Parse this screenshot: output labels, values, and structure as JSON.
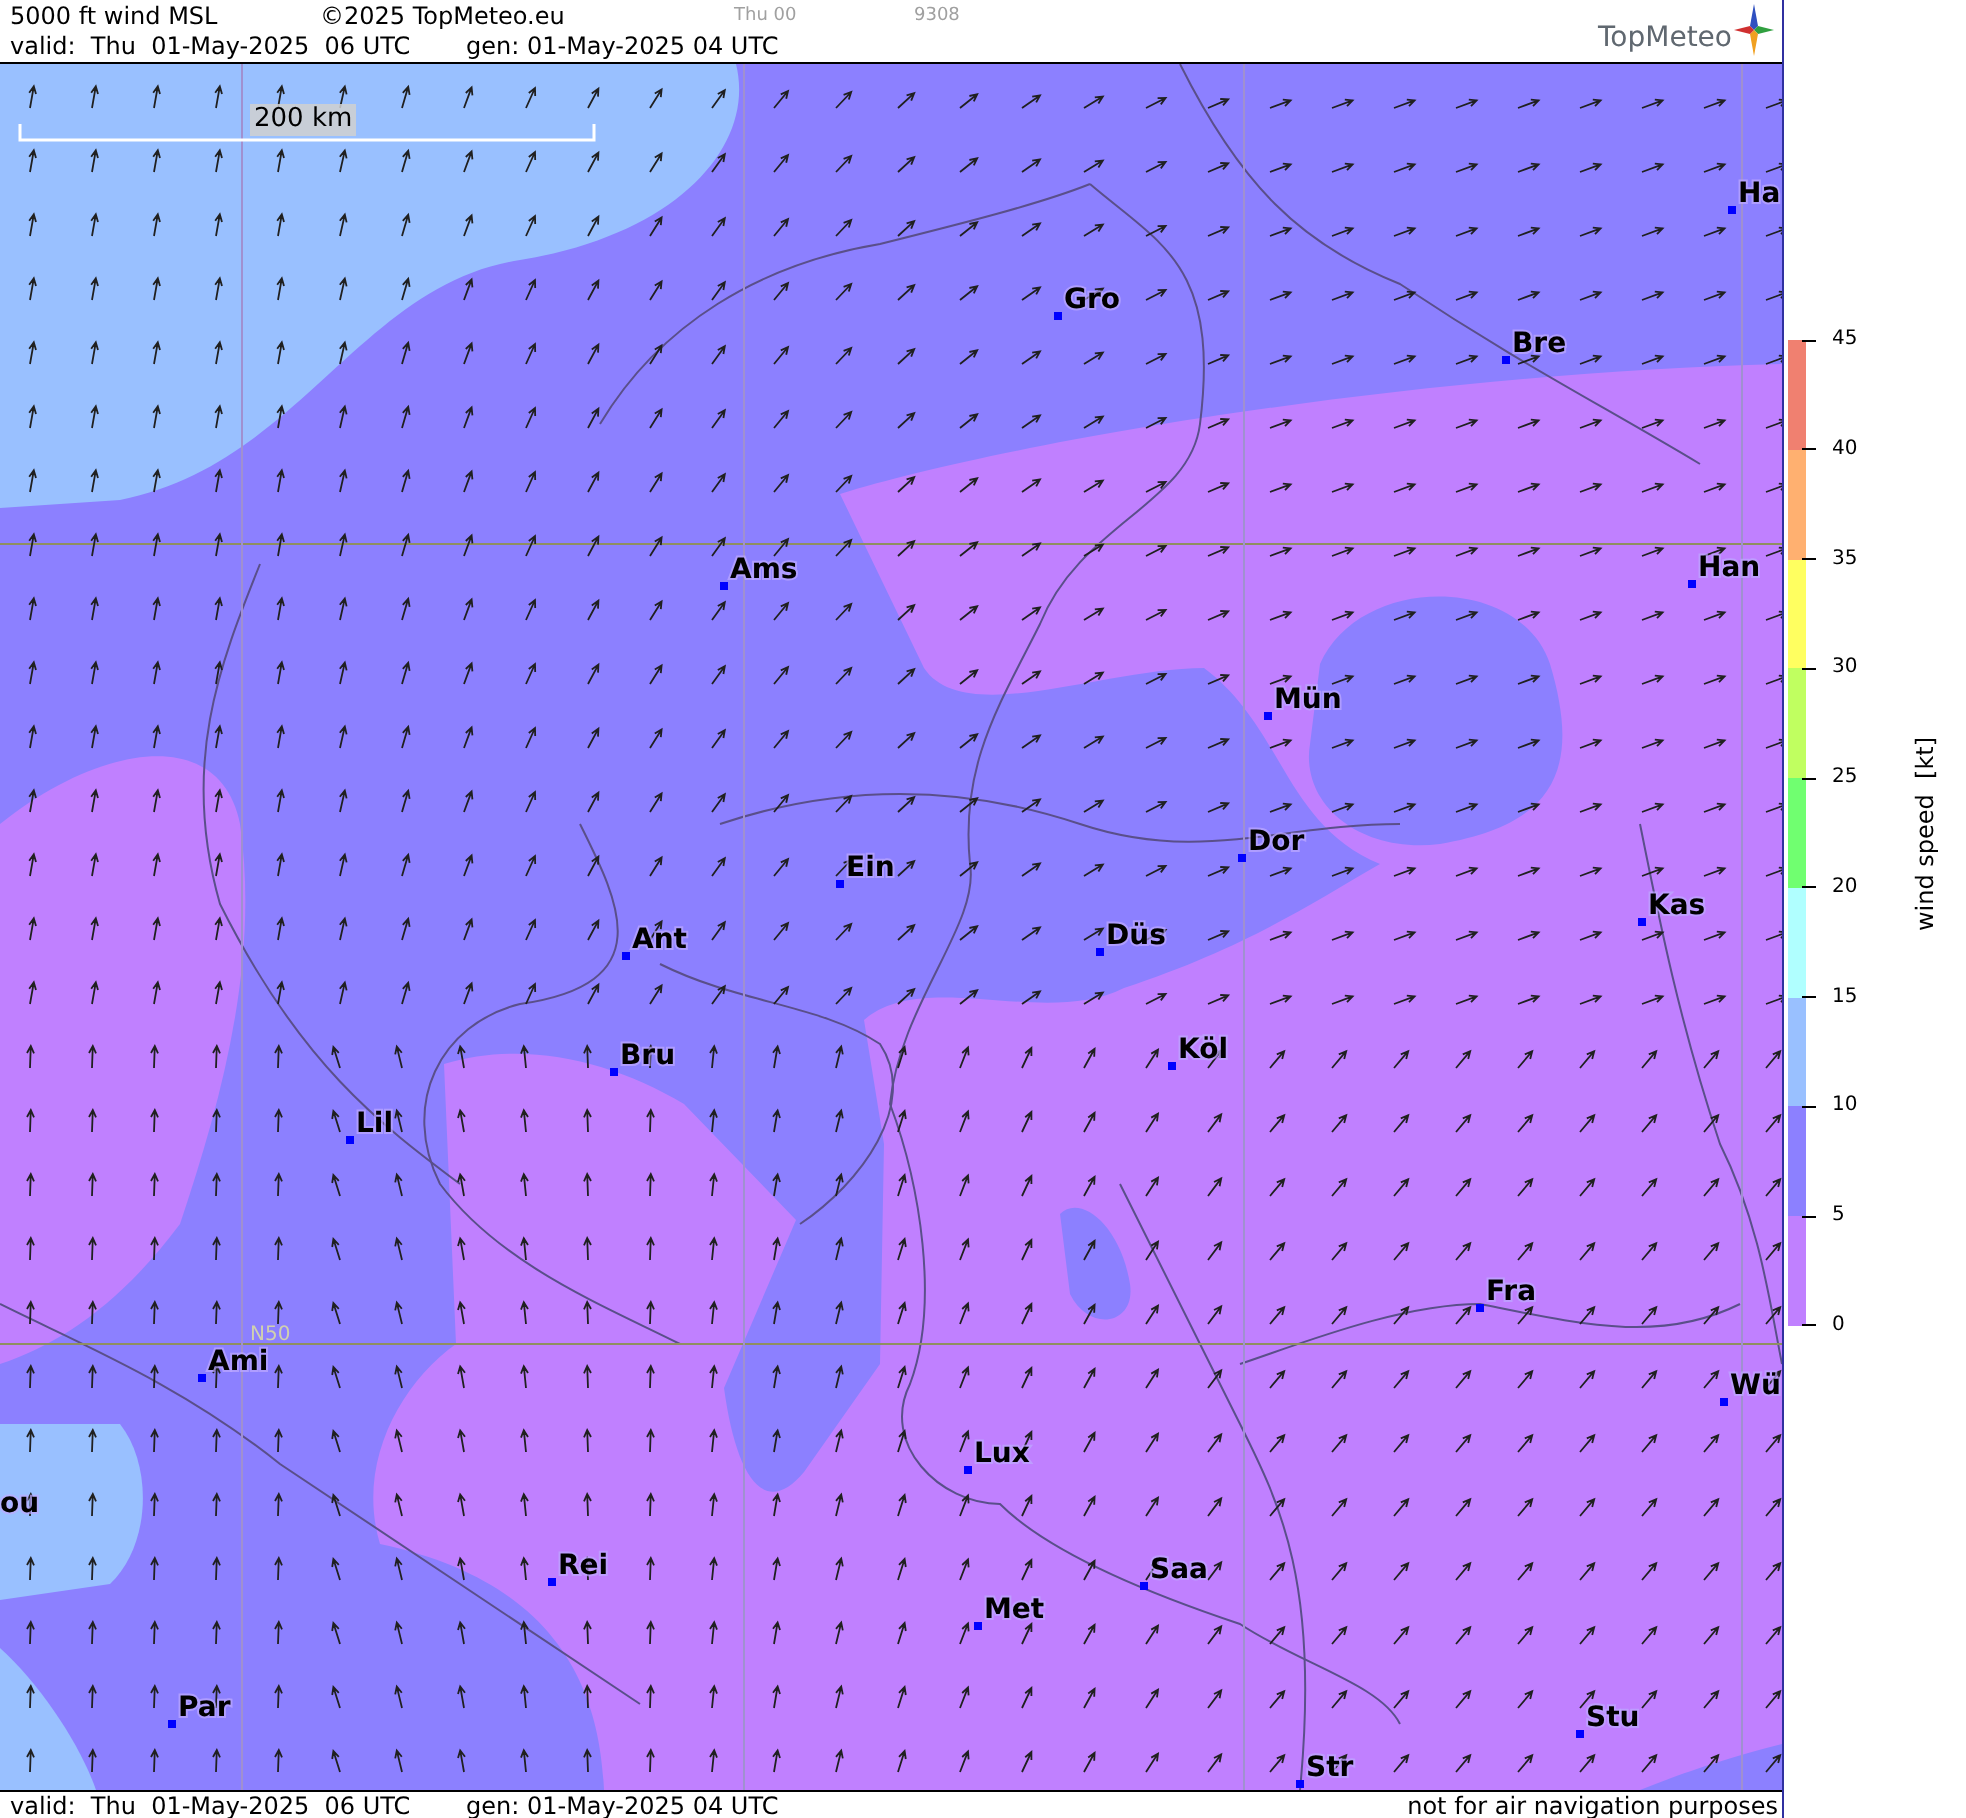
{
  "header": {
    "title": "5000 ft wind MSL",
    "copyright": "©2025 TopMeteo.eu",
    "run": "Thu 00",
    "code": "9308",
    "valid": "valid:  Thu  01-May-2025  06 UTC",
    "generated": "gen: 01-May-2025 04 UTC",
    "logo": "TopMeteo"
  },
  "map": {
    "scale_label": "200 km",
    "latitude_label": "N50",
    "cities": [
      {
        "name": "Ha"
      },
      {
        "name": "Gro"
      },
      {
        "name": "Bre"
      },
      {
        "name": "Ams"
      },
      {
        "name": "Han"
      },
      {
        "name": "Mün"
      },
      {
        "name": "Ein"
      },
      {
        "name": "Dor"
      },
      {
        "name": "Kas"
      },
      {
        "name": "Ant"
      },
      {
        "name": "Düs"
      },
      {
        "name": "Bru"
      },
      {
        "name": "Köl"
      },
      {
        "name": "Lil"
      },
      {
        "name": "Fra"
      },
      {
        "name": "Ami"
      },
      {
        "name": "Wü"
      },
      {
        "name": "Lux"
      },
      {
        "name": "ou"
      },
      {
        "name": "Rei"
      },
      {
        "name": "Saa"
      },
      {
        "name": "Met"
      },
      {
        "name": "Par"
      },
      {
        "name": "Stu"
      },
      {
        "name": "Str"
      }
    ]
  },
  "legend": {
    "title": "wind speed  [kt]",
    "ticks": [
      "45",
      "40",
      "35",
      "30",
      "25",
      "20",
      "15",
      "10",
      "5",
      "0"
    ],
    "bands": [
      {
        "color": "#f08070"
      },
      {
        "color": "#ffb070"
      },
      {
        "color": "#ffff60"
      },
      {
        "color": "#c0ff60"
      },
      {
        "color": "#70ff70"
      },
      {
        "color": "#b0ffff"
      },
      {
        "color": "#99c0ff"
      },
      {
        "color": "#8c80ff"
      },
      {
        "color": "#c080ff"
      }
    ]
  },
  "footer": {
    "valid": "valid:  Thu  01-May-2025  06 UTC",
    "generated": "gen: 01-May-2025 04 UTC",
    "disclaimer": "not for air navigation purposes"
  }
}
